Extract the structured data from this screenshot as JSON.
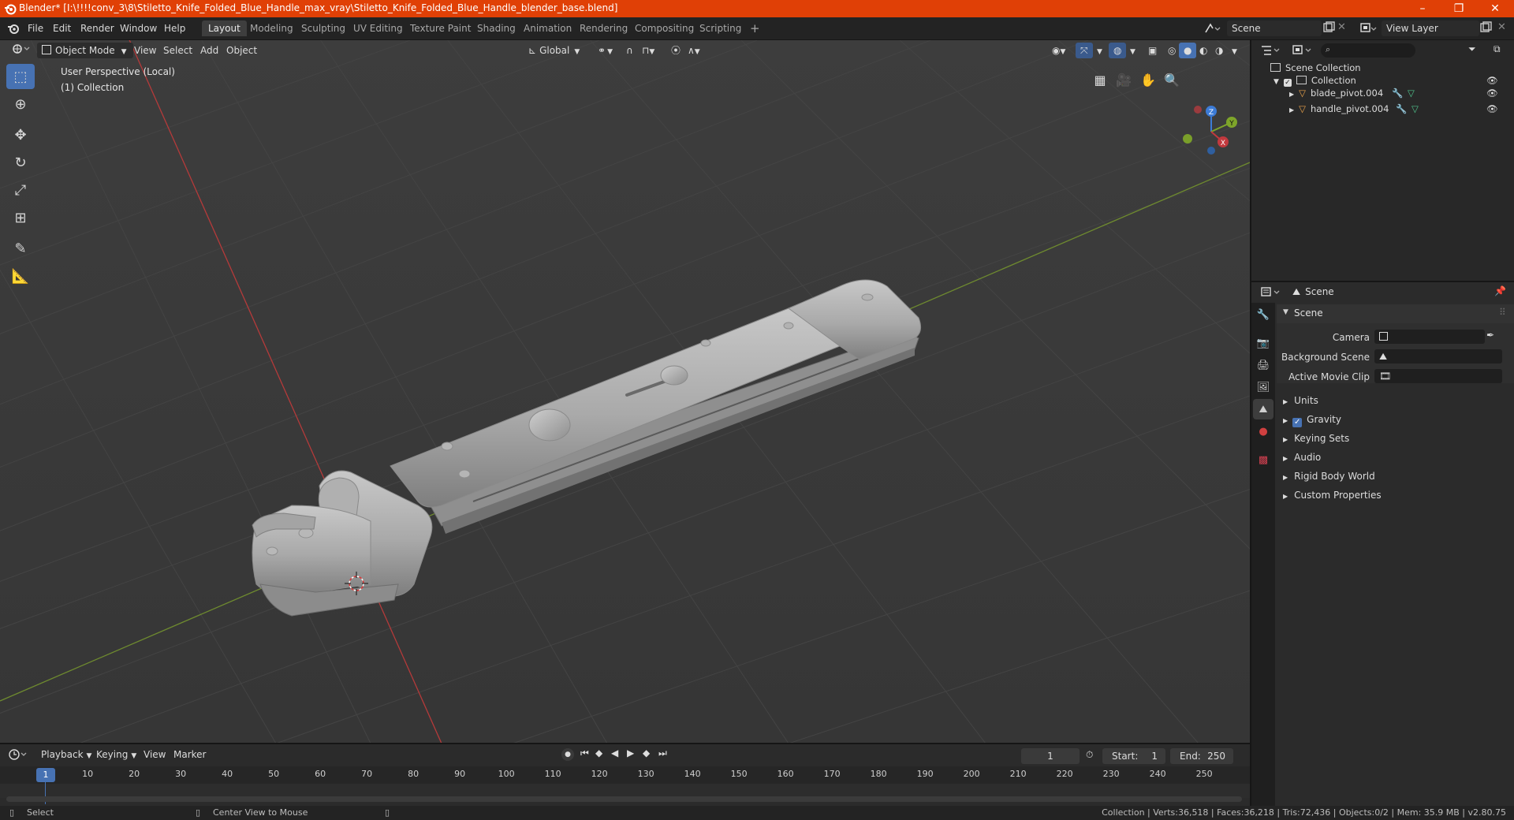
{
  "titlebar": {
    "title": "Blender* [I:\\!!!!conv_3\\8\\Stiletto_Knife_Folded_Blue_Handle_max_vray\\Stiletto_Knife_Folded_Blue_Handle_blender_base.blend]",
    "minimize": "–",
    "maximize": "❐",
    "close": "✕"
  },
  "menu": [
    "File",
    "Edit",
    "Render",
    "Window",
    "Help"
  ],
  "workspaces": {
    "active": "Layout",
    "tabs": [
      "Layout",
      "Modeling",
      "Sculpting",
      "UV Editing",
      "Texture Paint",
      "Shading",
      "Animation",
      "Rendering",
      "Compositing",
      "Scripting"
    ],
    "add": "+"
  },
  "scene_selector": {
    "label": "Scene"
  },
  "view_layer_selector": {
    "label": "View Layer"
  },
  "viewport_header": {
    "mode": "Object Mode",
    "menus": [
      "View",
      "Select",
      "Add",
      "Object"
    ],
    "transform_orientation": "Global"
  },
  "viewport_overlay": {
    "perspective": "User Perspective (Local)",
    "collection": "(1) Collection"
  },
  "gizmo": {
    "x": "X",
    "y": "Y",
    "z": "Z"
  },
  "outliner": {
    "root": "Scene Collection",
    "collection": "Collection",
    "objects": [
      "blade_pivot.004",
      "handle_pivot.004"
    ]
  },
  "properties": {
    "context": "Scene",
    "panel_title": "Scene",
    "fields": [
      {
        "label": "Camera"
      },
      {
        "label": "Background Scene"
      },
      {
        "label": "Active Movie Clip"
      }
    ],
    "subpanels": [
      "Units",
      "Gravity",
      "Keying Sets",
      "Audio",
      "Rigid Body World",
      "Custom Properties"
    ],
    "gravity_checked": true
  },
  "timeline": {
    "menus": [
      "Playback",
      "Keying",
      "View",
      "Marker"
    ],
    "current_frame": "1",
    "start_label": "Start:",
    "start": "1",
    "end_label": "End:",
    "end": "250",
    "ticks": [
      "1",
      "10",
      "20",
      "30",
      "40",
      "50",
      "60",
      "70",
      "80",
      "90",
      "100",
      "110",
      "120",
      "130",
      "140",
      "150",
      "160",
      "170",
      "180",
      "190",
      "200",
      "210",
      "220",
      "230",
      "240",
      "250"
    ]
  },
  "statusbar": {
    "select": "Select",
    "center_view": "Center View to Mouse",
    "stats": "Collection | Verts:36,518 | Faces:36,218 | Tris:72,436 | Objects:0/2 | Mem: 35.9 MB | v2.80.75"
  },
  "colors": {
    "titlebar": "#e04006",
    "accent": "#4772b3",
    "x_axis": "#c2393e",
    "y_axis": "#7ea52a",
    "z_axis": "#3c7bd6"
  }
}
